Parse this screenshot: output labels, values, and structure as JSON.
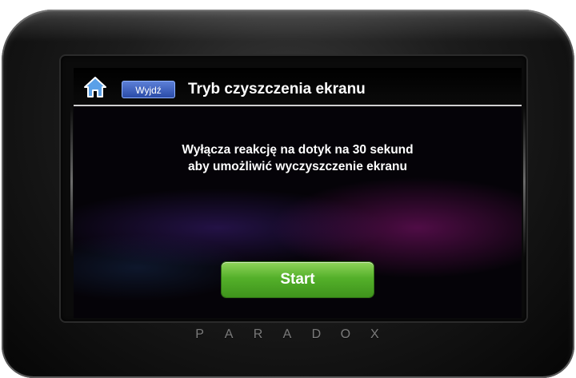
{
  "header": {
    "home_icon": "home-icon",
    "exit_label": "Wyjdź",
    "title": "Tryb czyszczenia ekranu"
  },
  "message": {
    "line1": "Wyłącza reakcję na dotyk na 30 sekund",
    "line2": "aby umożliwić wyczyszczenie ekranu"
  },
  "actions": {
    "start_label": "Start"
  },
  "brand": {
    "letters": [
      "P",
      "A",
      "R",
      "A",
      "D",
      "O",
      "X"
    ]
  },
  "colors": {
    "start_button": "#54b02a",
    "exit_button": "#2a4ba8",
    "home_icon": "#5aa0e8",
    "screen_background": "#050308"
  }
}
